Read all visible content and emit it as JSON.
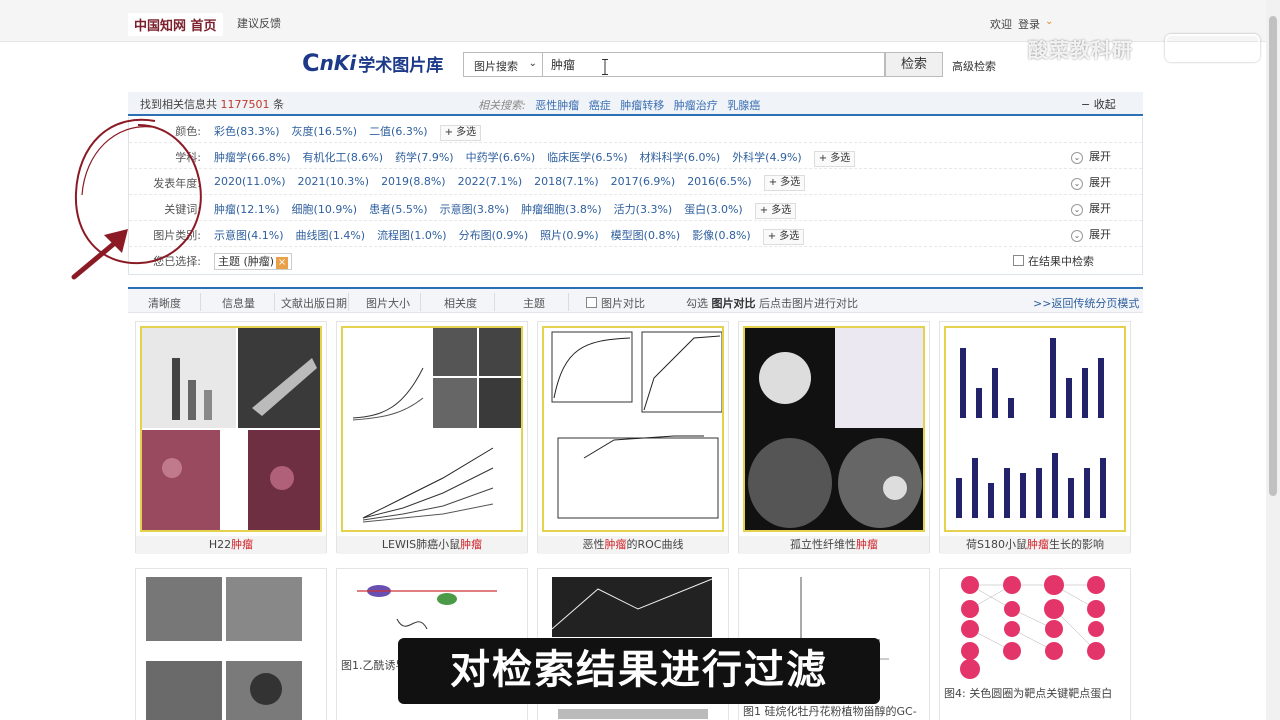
{
  "topbar": {
    "home_label": "中国知网 首页",
    "feedback_label": "建议反馈",
    "greeting": "欢迎",
    "login_label": "登录",
    "login_caret": "⌄"
  },
  "watermark": {
    "text": "酸菜教科研"
  },
  "brand": {
    "letter_c": "C",
    "letters_nki": "nKi",
    "name": "学术图片库"
  },
  "search": {
    "type_selected": "图片搜索",
    "type_arrow": "⌄",
    "query": "肿瘤",
    "button_label": "检索",
    "advanced_label": "高级检索"
  },
  "results": {
    "count_prefix": "找到相关信息共",
    "count": "1177501",
    "count_suffix": "条",
    "related_label": "相关搜索:",
    "related": [
      "恶性肿瘤",
      "癌症",
      "肿瘤转移",
      "肿瘤治疗",
      "乳腺癌"
    ],
    "collapse_label": "−  收起"
  },
  "filters": {
    "expand_label": "展开",
    "more_label": "+ 多选",
    "rows": [
      {
        "label": "颜色:",
        "items": [
          "彩色(83.3%)",
          "灰度(16.5%)",
          "二值(6.3%)"
        ],
        "expandable": false
      },
      {
        "label": "学科:",
        "items": [
          "肿瘤学(66.8%)",
          "有机化工(8.6%)",
          "药学(7.9%)",
          "中药学(6.6%)",
          "临床医学(6.5%)",
          "材料科学(6.0%)",
          "外科学(4.9%)"
        ],
        "expandable": true
      },
      {
        "label": "发表年度:",
        "items": [
          "2020(11.0%)",
          "2021(10.3%)",
          "2019(8.8%)",
          "2022(7.1%)",
          "2018(7.1%)",
          "2017(6.9%)",
          "2016(6.5%)"
        ],
        "expandable": true
      },
      {
        "label": "关键词:",
        "items": [
          "肿瘤(12.1%)",
          "细胞(10.9%)",
          "患者(5.5%)",
          "示意图(3.8%)",
          "肿瘤细胞(3.8%)",
          "活力(3.3%)",
          "蛋白(3.0%)"
        ],
        "expandable": true
      },
      {
        "label": "图片类别:",
        "items": [
          "示意图(4.1%)",
          "曲线图(1.4%)",
          "流程图(1.0%)",
          "分布图(0.9%)",
          "照片(0.9%)",
          "模型图(0.8%)",
          "影像(0.8%)"
        ],
        "expandable": true
      }
    ],
    "selected_label": "您已选择:",
    "selected_chip": "主题 (肿瘤)",
    "chip_close": "×",
    "within_label": "在结果中检索"
  },
  "sort": {
    "items": [
      "清晰度",
      "信息量",
      "文献出版日期",
      "图片大小",
      "相关度",
      "主题"
    ],
    "compare_label": "图片对比",
    "hint_pre": "勾选",
    "hint_bold": "图片对比",
    "hint_post": "后点击图片进行对比",
    "back_label": ">>返回传统分页模式"
  },
  "cards": [
    {
      "pre": "H22",
      "hl": "肿瘤",
      "post": ""
    },
    {
      "pre": "LEWIS肺癌小鼠",
      "hl": "肿瘤",
      "post": ""
    },
    {
      "pre": "恶性",
      "hl": "肿瘤",
      "post": "的ROC曲线"
    },
    {
      "pre": "孤立性纤维性",
      "hl": "肿瘤",
      "post": ""
    },
    {
      "pre": "荷S180小鼠",
      "hl": "肿瘤",
      "post": "生长的影响"
    }
  ],
  "cards_row2": [
    {
      "caption": ""
    },
    {
      "caption": "图1.乙酰诱导"
    },
    {
      "caption": ""
    },
    {
      "caption": "图1 硅烷化牡丹花粉植物甾醇的GC-"
    },
    {
      "caption": "图4: 关色圆圈为靶点关键靶点蛋白"
    }
  ],
  "subtitle": "对检索结果进行过滤",
  "colors": {
    "accent": "#2b6fb4",
    "highlight": "#d0242a",
    "annotation": "#8b1a24",
    "frame": "#e4d14d"
  }
}
